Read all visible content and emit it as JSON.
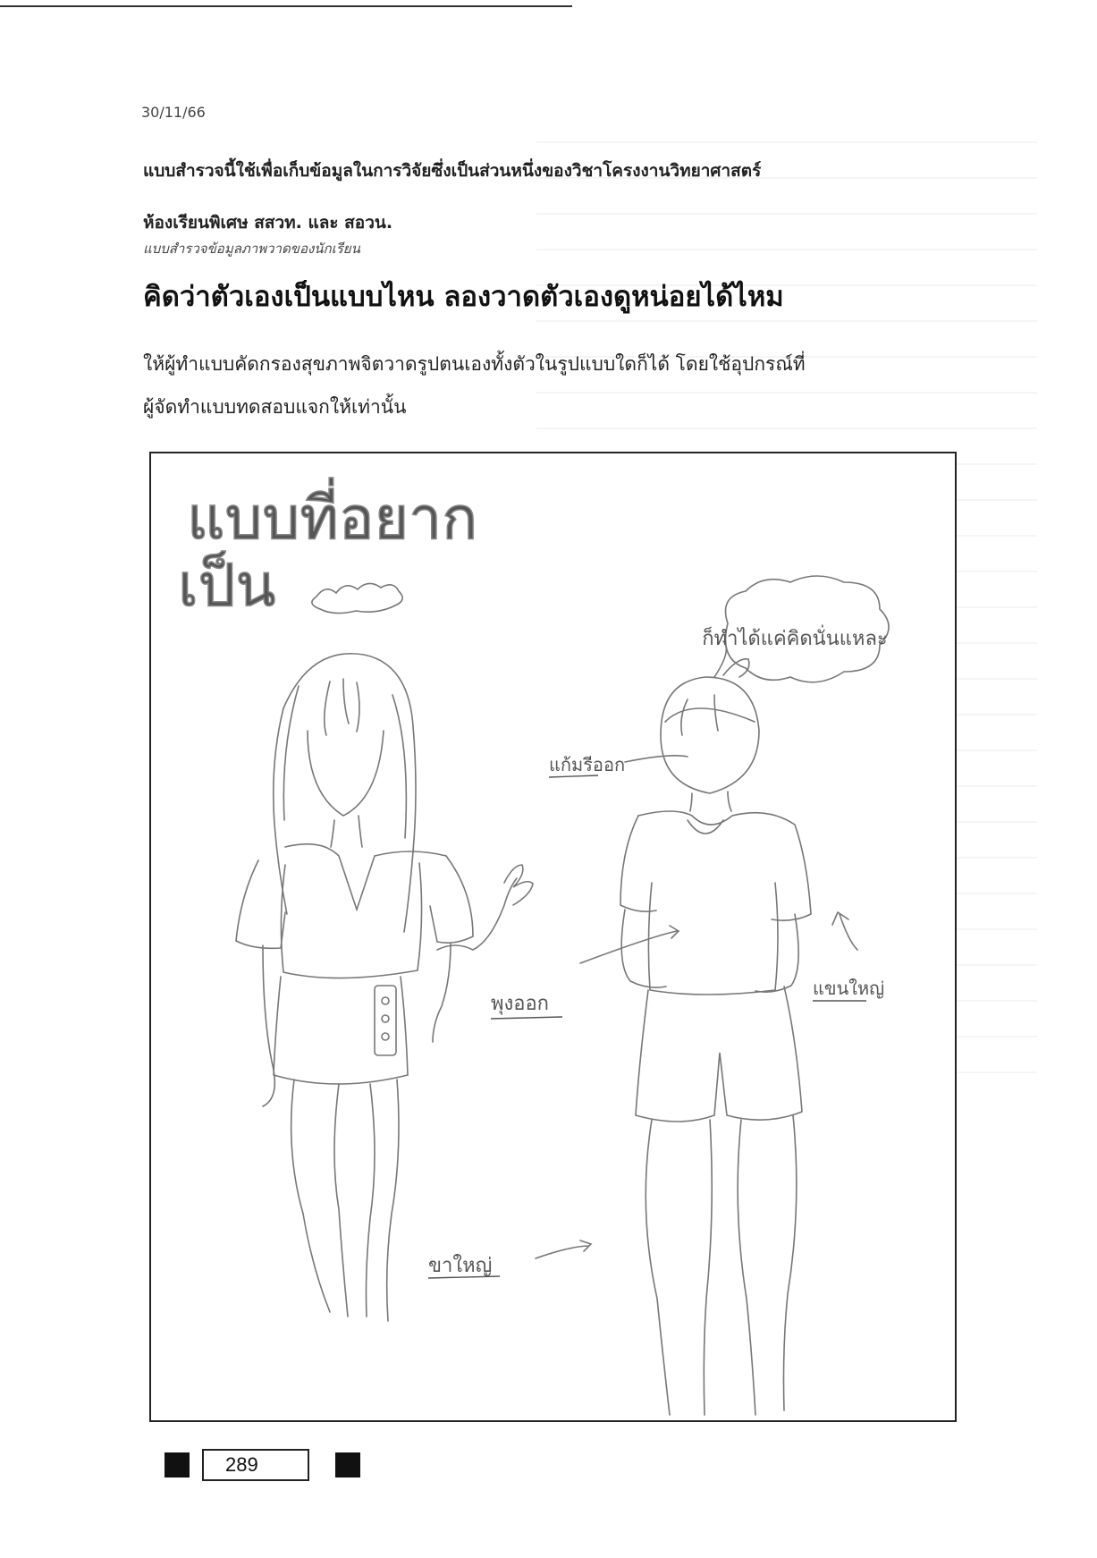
{
  "date": "30/11/66",
  "intro": {
    "line1": "แบบสำรวจนี้ใช้เพื่อเก็บข้อมูลในการวิจัยซึ่งเป็นส่วนหนึ่งของวิชาโครงงานวิทยาศาสตร์",
    "line2": "ห้องเรียนพิเศษ สสวท. และ สอวน."
  },
  "subtitle": "แบบสำรวจข้อมูลภาพวาดของนักเรียน",
  "heading": "คิดว่าตัวเองเป็นแบบไหน ลองวาดตัวเองดูหน่อยได้ไหม",
  "instructions": {
    "line1": "ให้ผู้ทำแบบคัดกรองสุขภาพจิตวาดรูปตนเองทั้งตัวในรูปแบบใดก็ได้ โดยใช้อุปกรณ์ที่",
    "line2": "ผู้จัดทำแบบทดสอบแจกให้เท่านั้น"
  },
  "drawing": {
    "title_line1": "แบบที่อยาก",
    "title_line2": "เป็น",
    "speech_bubble": "ก็ทำได้แค่คิดนั่นแหละ",
    "label_face": "แก้มรีออก",
    "label_belly": "พุงออก",
    "label_arms": "แขนใหญ่",
    "label_legs": "ขาใหญ่"
  },
  "footer": {
    "id": "289"
  }
}
